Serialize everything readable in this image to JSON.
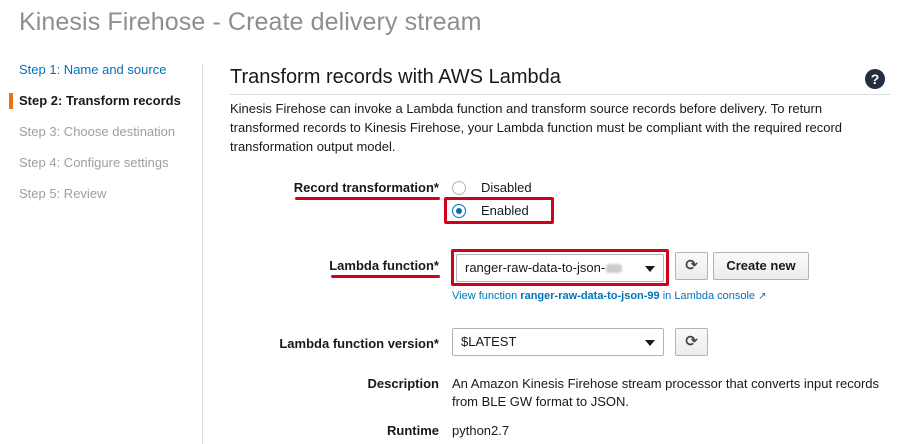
{
  "page": {
    "title": "Kinesis Firehose - Create delivery stream"
  },
  "steps": [
    {
      "label": "Step 1: Name and source"
    },
    {
      "label": "Step 2: Transform records"
    },
    {
      "label": "Step 3: Choose destination"
    },
    {
      "label": "Step 4: Configure settings"
    },
    {
      "label": "Step 5: Review"
    }
  ],
  "section": {
    "title": "Transform records with AWS Lambda",
    "help_icon": "question-icon",
    "description": "Kinesis Firehose can invoke a Lambda function and transform source records before delivery. To return transformed records to Kinesis Firehose, your Lambda function must be compliant with the required record transformation output model."
  },
  "record_transformation": {
    "label": "Record transformation*",
    "options": [
      {
        "label": "Disabled",
        "checked": false
      },
      {
        "label": "Enabled",
        "checked": true
      }
    ]
  },
  "lambda_function": {
    "label": "Lambda function*",
    "value": "ranger-raw-data-to-json-",
    "create_new_label": "Create new",
    "view_prefix": "View function ",
    "view_name": "ranger-raw-data-to-json-99",
    "view_suffix": " in Lambda console"
  },
  "lambda_version": {
    "label": "Lambda function version*",
    "value": "$LATEST"
  },
  "details": {
    "description_label": "Description",
    "description_value": "An Amazon Kinesis Firehose stream processor that converts input records from BLE GW format to JSON.",
    "runtime_label": "Runtime",
    "runtime_value": "python2.7"
  },
  "colors": {
    "accent": "#0073bb",
    "active_step_marker": "#ec7211",
    "annotation_red": "#d0021b"
  }
}
